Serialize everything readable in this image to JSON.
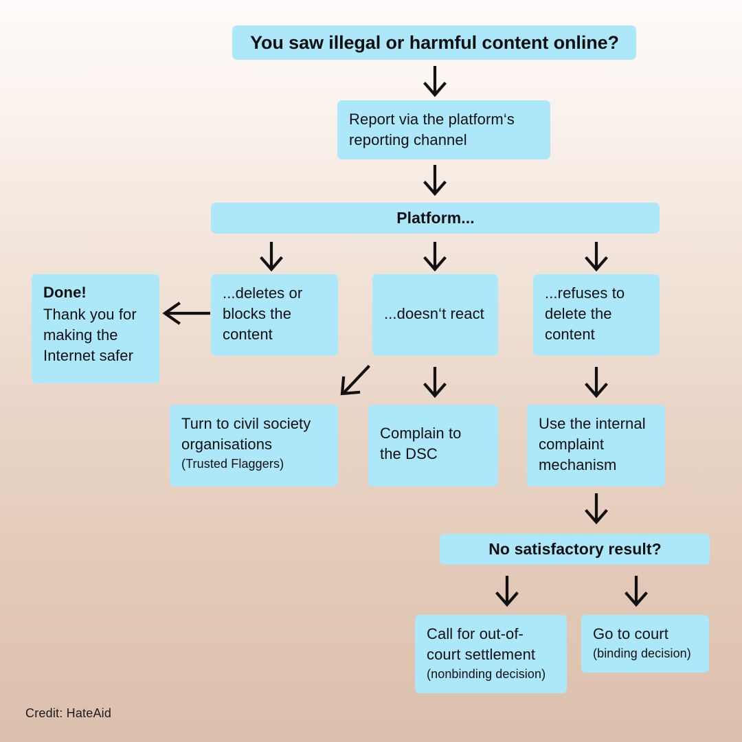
{
  "meta": {
    "colors": {
      "node_fill": "#ade8fa",
      "text": "#0f0f0f",
      "arrow": "#111111",
      "bg_top": "#fdfbfa",
      "bg_bottom": "#dcc0ae"
    }
  },
  "chart_data": {
    "type": "diagram",
    "title": "You saw illegal or harmful content online?",
    "nodes": [
      {
        "id": "start",
        "label": "You saw illegal or harmful content online?"
      },
      {
        "id": "report",
        "label": "Report via the platform‘s reporting channel"
      },
      {
        "id": "platform",
        "label": "Platform..."
      },
      {
        "id": "deletes",
        "label": "...deletes or blocks the content"
      },
      {
        "id": "noreact",
        "label": "...doesn‘t react"
      },
      {
        "id": "refuses",
        "label": "...refuses to delete the content"
      },
      {
        "id": "done",
        "label": "Done! Thank you for making the Internet safer"
      },
      {
        "id": "civil",
        "label": "Turn to civil society organisations (Trusted Flaggers)"
      },
      {
        "id": "dsc",
        "label": "Complain to the DSC"
      },
      {
        "id": "internal",
        "label": "Use the internal complaint mechanism"
      },
      {
        "id": "nosat",
        "label": "No satisfactory result?"
      },
      {
        "id": "oocs",
        "label": "Call for out-of-court settlement (nonbinding decision)"
      },
      {
        "id": "court",
        "label": "Go to court (binding decision)"
      }
    ],
    "edges": [
      {
        "from": "start",
        "to": "report",
        "direction": "down"
      },
      {
        "from": "report",
        "to": "platform",
        "direction": "down"
      },
      {
        "from": "platform",
        "to": "deletes",
        "direction": "down"
      },
      {
        "from": "platform",
        "to": "noreact",
        "direction": "down"
      },
      {
        "from": "platform",
        "to": "refuses",
        "direction": "down"
      },
      {
        "from": "deletes",
        "to": "done",
        "direction": "left"
      },
      {
        "from": "deletes",
        "to": "civil",
        "direction": "down-left"
      },
      {
        "from": "noreact",
        "to": "dsc",
        "direction": "down"
      },
      {
        "from": "refuses",
        "to": "internal",
        "direction": "down"
      },
      {
        "from": "internal",
        "to": "nosat",
        "direction": "down"
      },
      {
        "from": "nosat",
        "to": "oocs",
        "direction": "down"
      },
      {
        "from": "nosat",
        "to": "court",
        "direction": "down"
      }
    ]
  },
  "flow": {
    "start": {
      "label": "You saw illegal or harmful content online?"
    },
    "report": {
      "line1": "Report via the platform‘s",
      "line2": "reporting channel"
    },
    "platform": {
      "label": "Platform..."
    },
    "branch_deletes": {
      "line1": "...deletes or",
      "line2": "blocks the",
      "line3": "content"
    },
    "branch_noreact": {
      "label": "...doesn‘t react"
    },
    "branch_refuses": {
      "line1": "...refuses to",
      "line2": "delete the",
      "line3": "content"
    },
    "done": {
      "headline": "Done!",
      "line1": "Thank you for",
      "line2": "making the",
      "line3": "Internet safer"
    },
    "civil": {
      "line1": "Turn to civil society",
      "line2": "organisations",
      "note": "(Trusted Flaggers)"
    },
    "dsc": {
      "line1": "Complain to",
      "line2": "the DSC"
    },
    "internal": {
      "line1": "Use the internal",
      "line2": "complaint",
      "line3": "mechanism"
    },
    "no_satisfactory": {
      "label": "No satisfactory result?"
    },
    "settlement": {
      "line1": "Call for out-of-",
      "line2": "court settlement",
      "note": "(nonbinding decision)"
    },
    "court": {
      "line1": "Go to court",
      "note": "(binding decision)"
    }
  },
  "footer": {
    "credit": "Credit: HateAid"
  }
}
